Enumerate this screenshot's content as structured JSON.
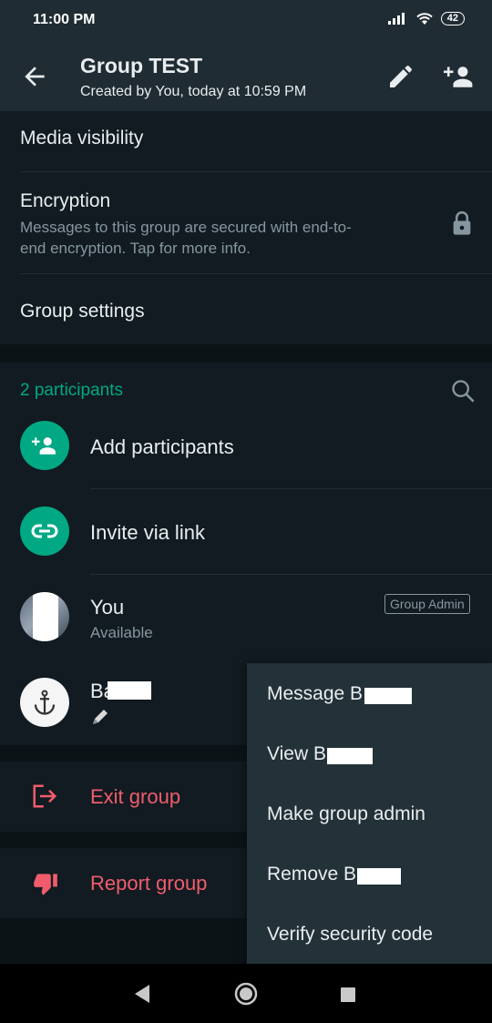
{
  "status_bar": {
    "time": "11:00 PM",
    "battery": "42"
  },
  "header": {
    "title": "Group TEST",
    "subtitle": "Created by You, today at 10:59 PM"
  },
  "settings": {
    "media_visibility": "Media visibility",
    "encryption_title": "Encryption",
    "encryption_subtitle": "Messages to this group are secured with end-to-end encryption. Tap for more info.",
    "group_settings": "Group settings"
  },
  "participants": {
    "header": "2 participants",
    "add_label": "Add participants",
    "invite_label": "Invite via link",
    "members": [
      {
        "name": "You",
        "status": "Available",
        "badge": "Group Admin"
      },
      {
        "name": "Ba",
        "status": ""
      }
    ]
  },
  "actions": {
    "exit_group": "Exit group",
    "report_group": "Report group"
  },
  "context_menu": {
    "items": [
      "Message B",
      "View B",
      "Make group admin",
      "Remove B",
      "Verify security code"
    ]
  },
  "colors": {
    "accent": "#00a884",
    "danger": "#f15c6d",
    "background": "#0c1317",
    "surface": "#111b21",
    "header": "#1f2c33",
    "menu": "#233138"
  }
}
